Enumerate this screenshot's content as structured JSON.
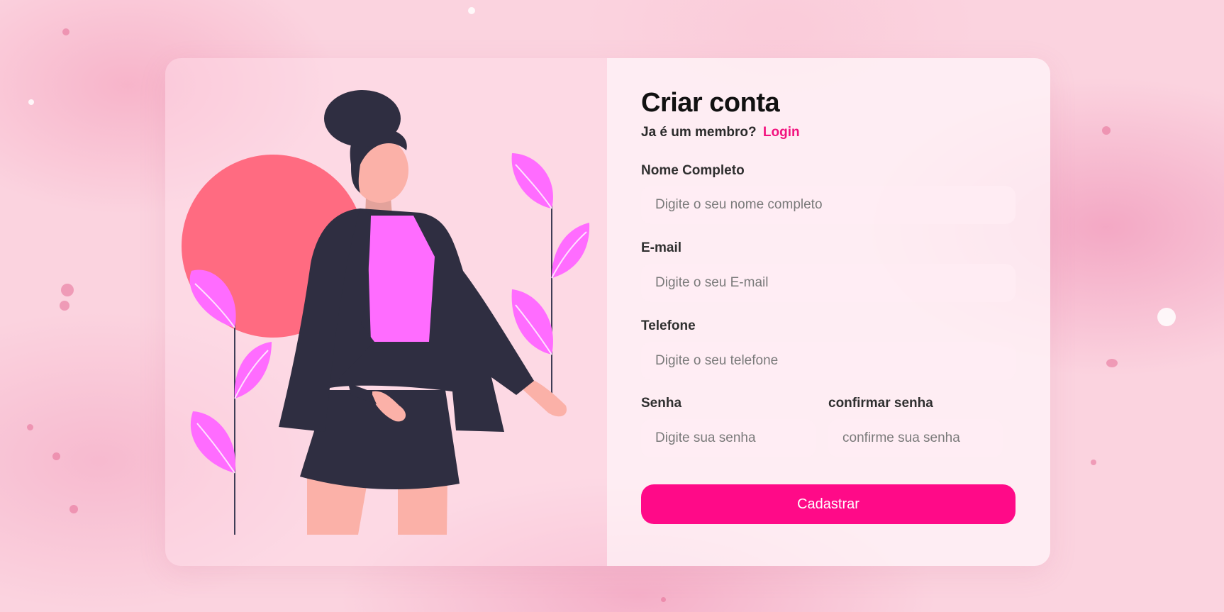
{
  "signup": {
    "title": "Criar conta",
    "member_prompt": "Ja é um membro?",
    "login_link": "Login",
    "fields": {
      "full_name": {
        "label": "Nome Completo",
        "placeholder": "Digite o seu nome completo",
        "value": ""
      },
      "email": {
        "label": "E-mail",
        "placeholder": "Digite o seu E-mail",
        "value": ""
      },
      "phone": {
        "label": "Telefone",
        "placeholder": "Digite o seu telefone",
        "value": ""
      },
      "password": {
        "label": "Senha",
        "placeholder": "Digite sua senha",
        "value": ""
      },
      "confirm_password": {
        "label": "confirmar senha",
        "placeholder": "confirme sua senha",
        "value": ""
      }
    },
    "submit_label": "Cadastrar"
  },
  "colors": {
    "accent": "#ff0a88",
    "link": "#f2137f",
    "title": "#111111",
    "illustration_jacket": "#2f2e41",
    "illustration_top": "#ff6cff",
    "illustration_sun": "#ff6b81",
    "illustration_skin": "#fbb1a8"
  },
  "illustration": {
    "name": "woman-with-plants",
    "icons": [
      "sun-circle-icon",
      "woman-figure-icon",
      "leaf-plant-icon"
    ]
  }
}
